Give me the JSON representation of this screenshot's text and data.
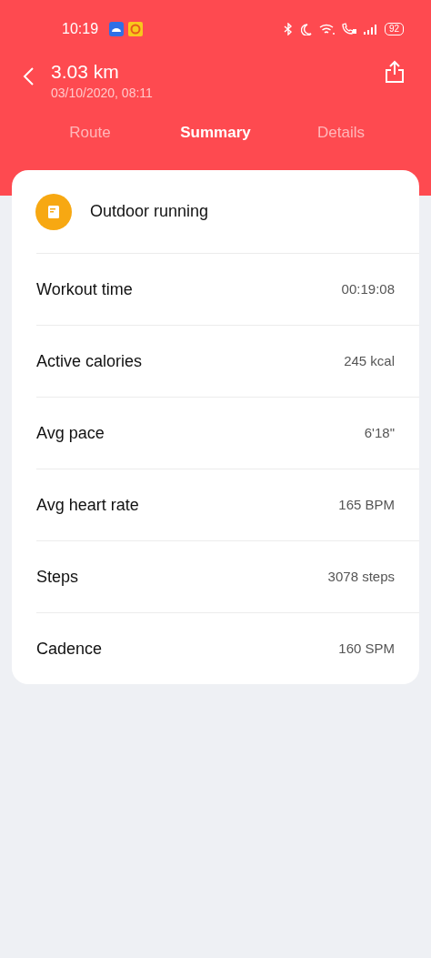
{
  "status_bar": {
    "time": "10:19",
    "battery": "92"
  },
  "header": {
    "title": "3.03 km",
    "subtitle": "03/10/2020, 08:11"
  },
  "tabs": [
    {
      "label": "Route",
      "selected": false
    },
    {
      "label": "Summary",
      "selected": true
    },
    {
      "label": "Details",
      "selected": false
    }
  ],
  "activity": {
    "name": "Outdoor running"
  },
  "stats": [
    {
      "label": "Workout time",
      "value": "00:19:08"
    },
    {
      "label": "Active calories",
      "value": "245 kcal"
    },
    {
      "label": "Avg pace",
      "value": "6'18\""
    },
    {
      "label": "Avg heart rate",
      "value": "165 BPM"
    },
    {
      "label": "Steps",
      "value": "3078 steps"
    },
    {
      "label": "Cadence",
      "value": "160 SPM"
    }
  ]
}
